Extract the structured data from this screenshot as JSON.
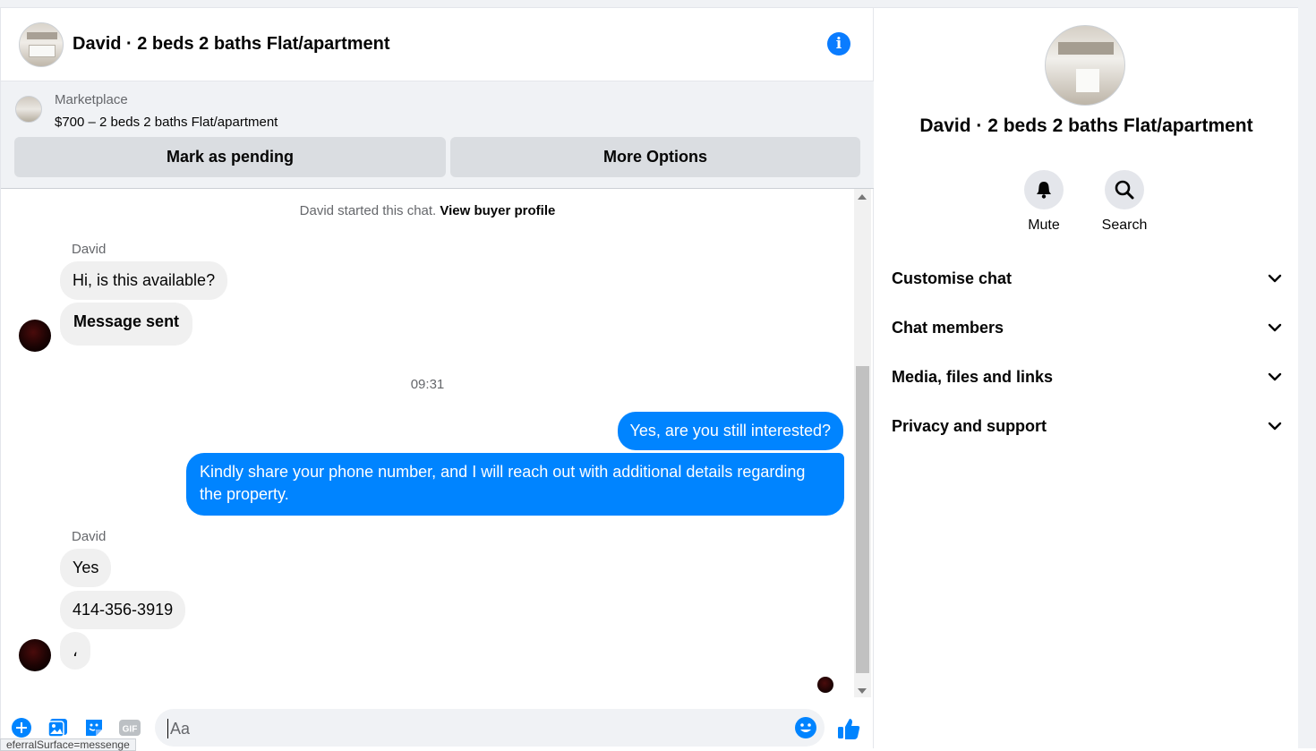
{
  "header": {
    "title": "David · 2 beds 2 baths Flat/apartment"
  },
  "marketplace": {
    "label": "Marketplace",
    "price_line": "$700 – 2 beds 2 baths Flat/apartment",
    "mark_pending": "Mark as pending",
    "more_options": "More Options"
  },
  "thread": {
    "started_text": "David started this chat.",
    "view_buyer_profile": "View buyer profile",
    "group1": {
      "sender": "David",
      "messages": [
        "Hi, is this available?",
        "Message sent"
      ]
    },
    "timestamp": "09:31",
    "outgoing": [
      "Yes, are you still interested?",
      "Kindly share your phone number, and I will reach out with additional details regarding the property."
    ],
    "group2": {
      "sender": "David",
      "messages": [
        "Yes",
        "414-356-3919",
        "،"
      ]
    }
  },
  "composer": {
    "placeholder": "Aa",
    "icons": [
      "plus-icon",
      "photo-icon",
      "sticker-icon",
      "gif-icon",
      "emoji-icon",
      "like-icon"
    ],
    "gif_label": "GIF",
    "status_url": "eferralSurface=messenge"
  },
  "info_panel": {
    "title": "David · 2 beds 2 baths Flat/apartment",
    "actions": [
      {
        "label": "Mute",
        "icon": "bell-icon"
      },
      {
        "label": "Search",
        "icon": "search-icon"
      }
    ],
    "sections": [
      "Customise chat",
      "Chat members",
      "Media, files and links",
      "Privacy and support"
    ]
  },
  "colors": {
    "accent": "#0084ff",
    "incoming_bubble": "#f0f0f0",
    "panel_bg": "#f0f2f5"
  }
}
